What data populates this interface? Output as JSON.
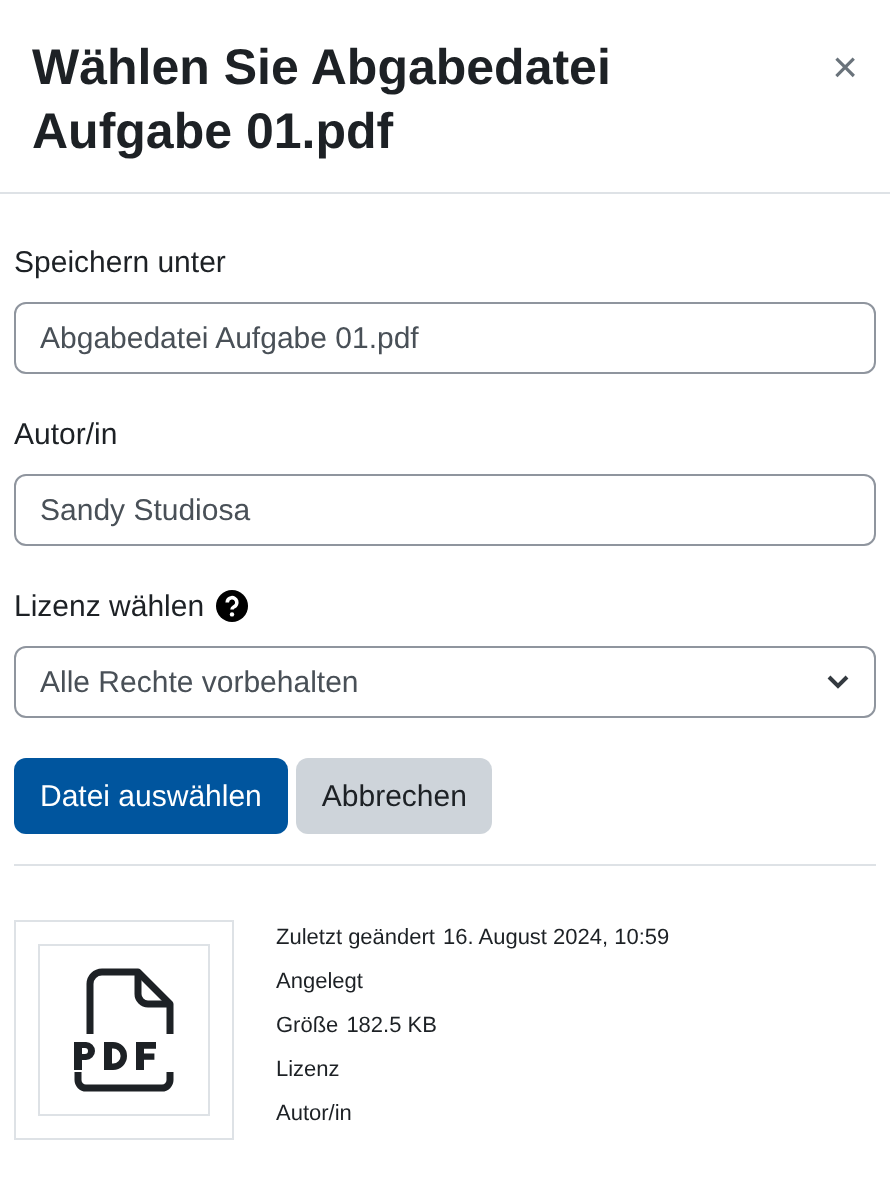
{
  "dialog": {
    "title": "Wählen Sie Abgabedatei Aufgabe 01.pdf",
    "close": "×"
  },
  "fields": [
    {
      "kind": "text",
      "label": "Speichern unter",
      "value": "Abgabedatei Aufgabe 01.pdf"
    },
    {
      "kind": "text",
      "label": "Autor/in",
      "value": "Sandy Studiosa"
    },
    {
      "kind": "select",
      "label": "Lizenz wählen",
      "help": true,
      "value": "Alle Rechte vorbehalten"
    }
  ],
  "buttons": [
    {
      "label": "Datei auswählen",
      "primary": true
    },
    {
      "label": "Abbrechen",
      "primary": false
    }
  ],
  "details": [
    {
      "label": "Zuletzt geändert",
      "value": "16. August 2024, 10:59"
    },
    {
      "label": "Angelegt"
    },
    {
      "label": "Größe",
      "value": "182.5 KB"
    },
    {
      "label": "Lizenz"
    },
    {
      "label": "Autor/in"
    }
  ]
}
